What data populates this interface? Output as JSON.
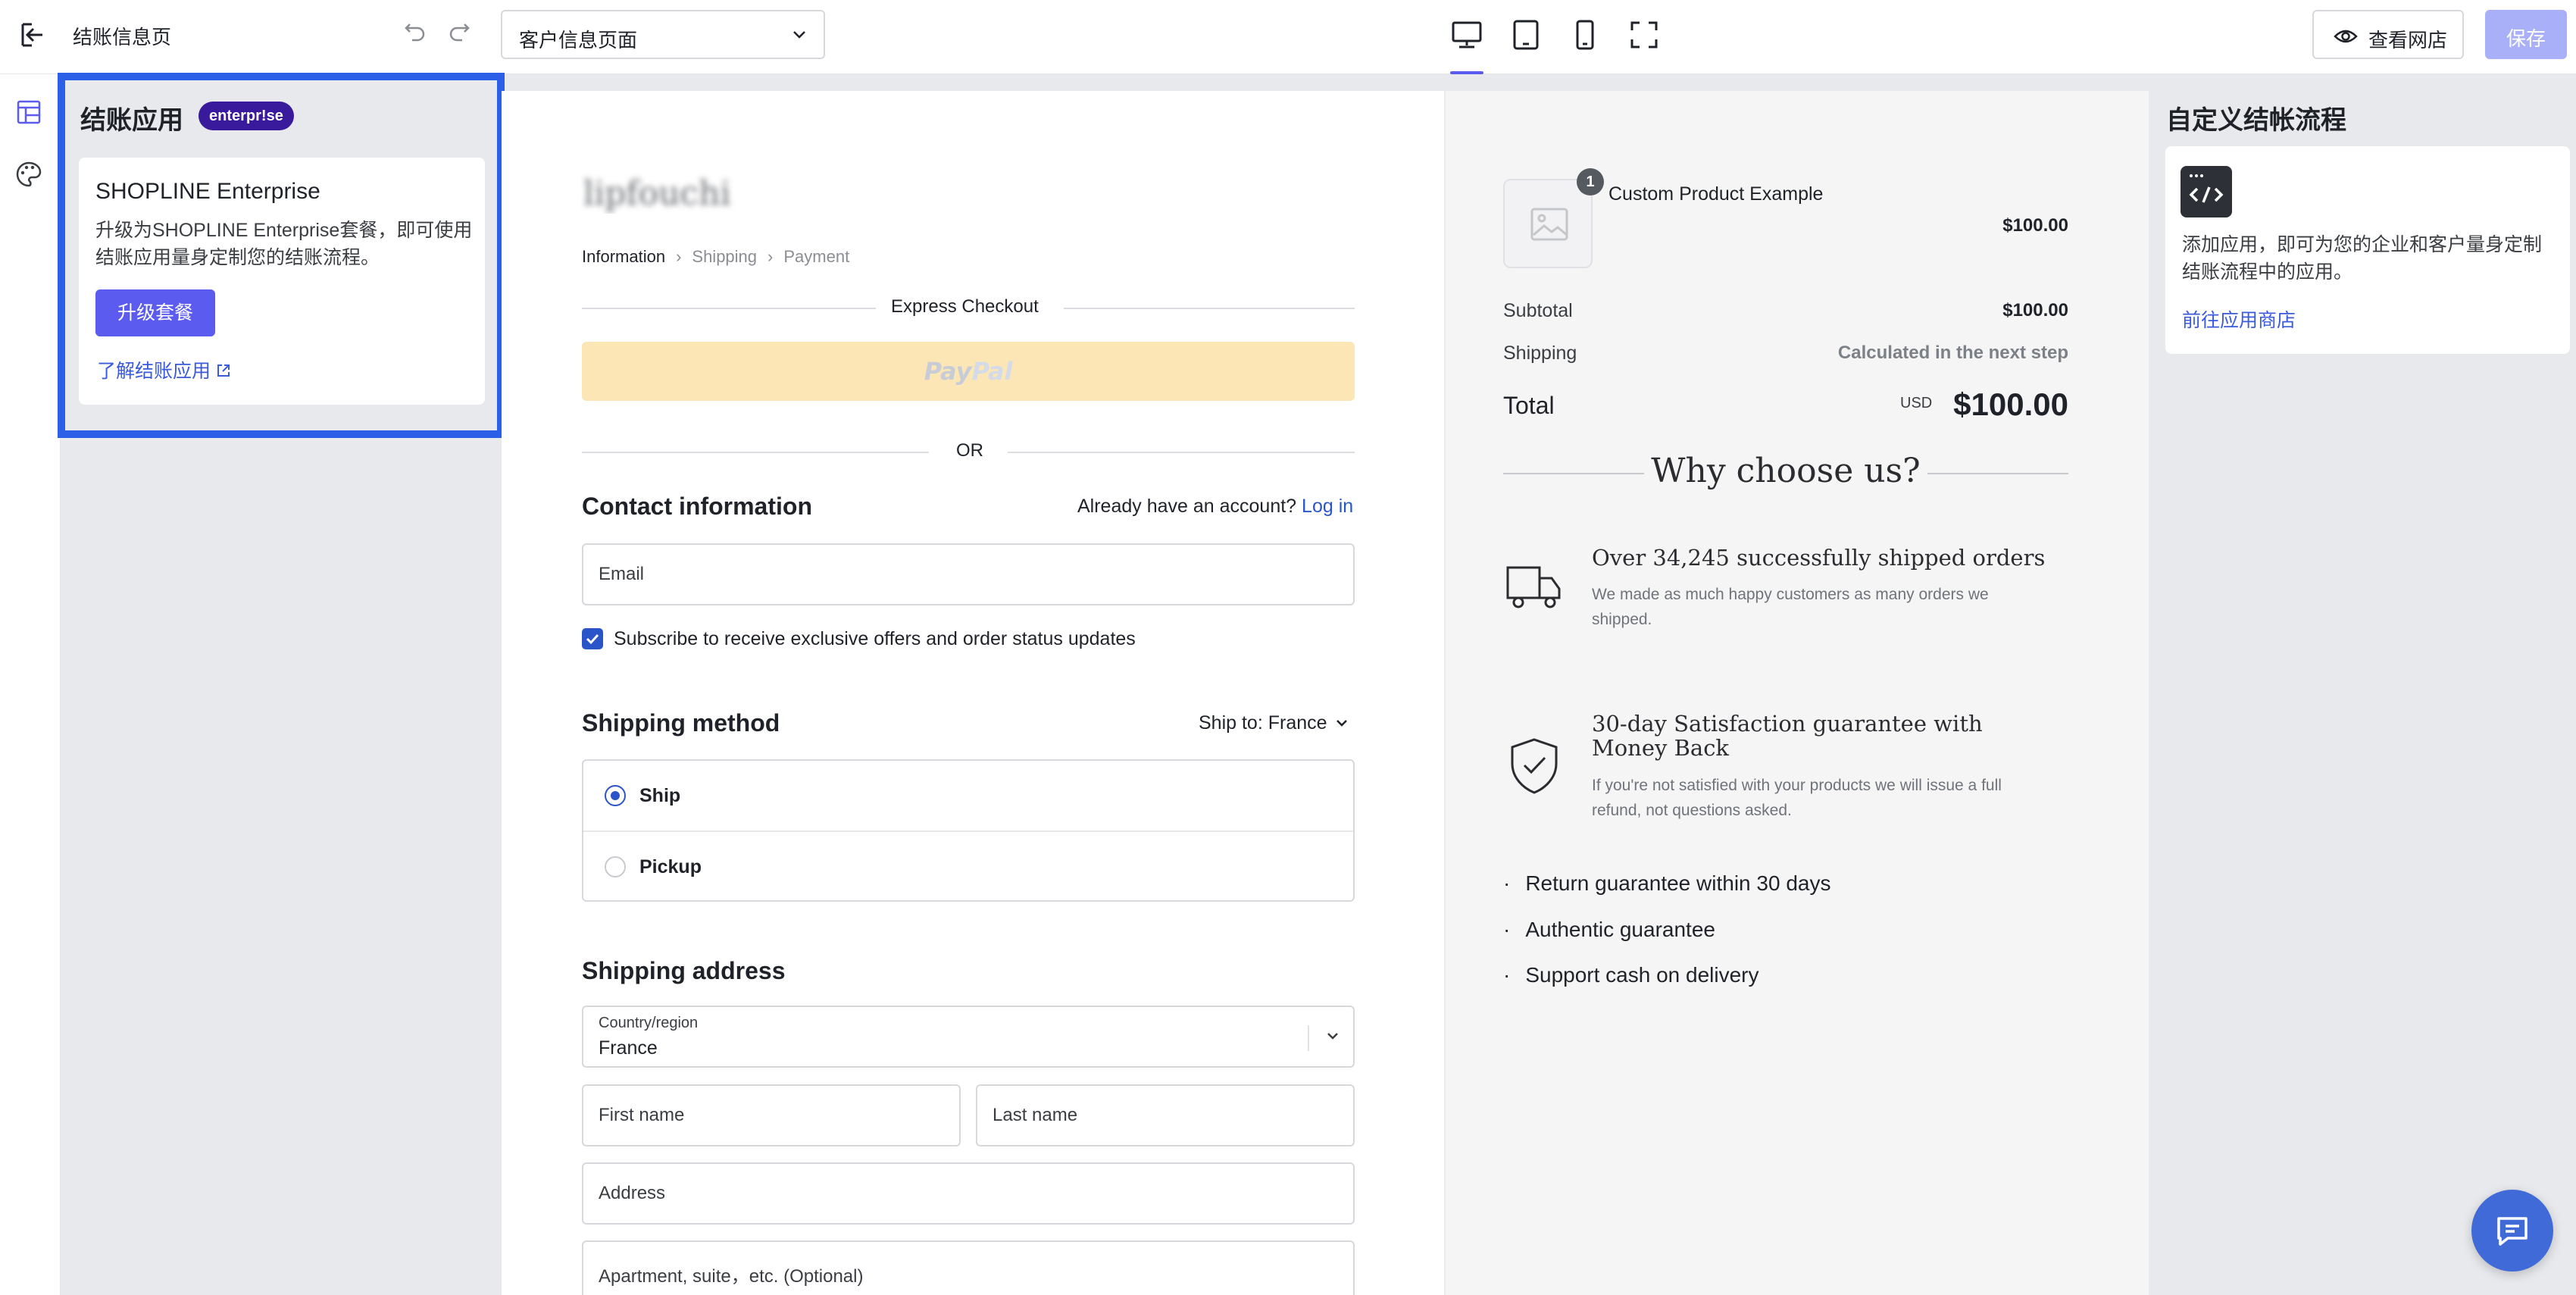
{
  "topbar": {
    "page_name": "结账信息页",
    "page_select_value": "客户信息页面",
    "view_store_label": "查看网店",
    "save_label": "保存"
  },
  "left_panel": {
    "title": "结账应用",
    "badge": "enterpr!se",
    "card_title": "SHOPLINE Enterprise",
    "card_desc": "升级为SHOPLINE Enterprise套餐，即可使用结账应用量身定制您的结账流程。",
    "upgrade_label": "升级套餐",
    "learn_link": "了解结账应用"
  },
  "checkout": {
    "logo_text": "lipfouchi",
    "breadcrumb": {
      "step1": "Information",
      "step2": "Shipping",
      "step3": "Payment"
    },
    "express_label": "Express Checkout",
    "paypal_a": "Pay",
    "paypal_b": "Pal",
    "or_label": "OR",
    "contact_title": "Contact information",
    "account_prompt": "Already have an account?",
    "login_link": "Log in",
    "email_placeholder": "Email",
    "subscribe_label": "Subscribe to receive exclusive offers and order status updates",
    "shipping_method_title": "Shipping method",
    "ship_to_label": "Ship to:",
    "ship_to_value": "France",
    "options": [
      {
        "label": "Ship",
        "selected": true
      },
      {
        "label": "Pickup",
        "selected": false
      }
    ],
    "address_title": "Shipping address",
    "country_label": "Country/region",
    "country_value": "France",
    "first_name": "First name",
    "last_name": "Last name",
    "address": "Address",
    "apartment": "Apartment, suite，etc. (Optional)"
  },
  "summary": {
    "qty": "1",
    "product_name": "Custom Product Example",
    "product_price": "$100.00",
    "subtotal_label": "Subtotal",
    "subtotal_value": "$100.00",
    "shipping_label": "Shipping",
    "shipping_value": "Calculated in the next step",
    "total_label": "Total",
    "currency": "USD",
    "total_value": "$100.00",
    "why_title": "Why choose us?",
    "features": [
      {
        "title": "Over 34,245 successfully shipped orders",
        "desc": "We made as much happy customers as many orders we shipped."
      },
      {
        "title": "30-day Satisfaction guarantee with Money Back",
        "desc": "If you're not satisfied with your products we will issue a full refund, not questions asked."
      }
    ],
    "bullets": [
      "Return guarantee within 30 days",
      "Authentic guarantee",
      "Support cash on delivery"
    ]
  },
  "right_panel": {
    "title": "自定义结帐流程",
    "desc": "添加应用，即可为您的企业和客户量身定制结账流程中的应用。",
    "link": "前往应用商店"
  },
  "colors": {
    "accent": "#5b5bf0",
    "highlight_border": "#2c5fe8",
    "link": "#2a55c8",
    "badge": "#3a1a9c"
  }
}
